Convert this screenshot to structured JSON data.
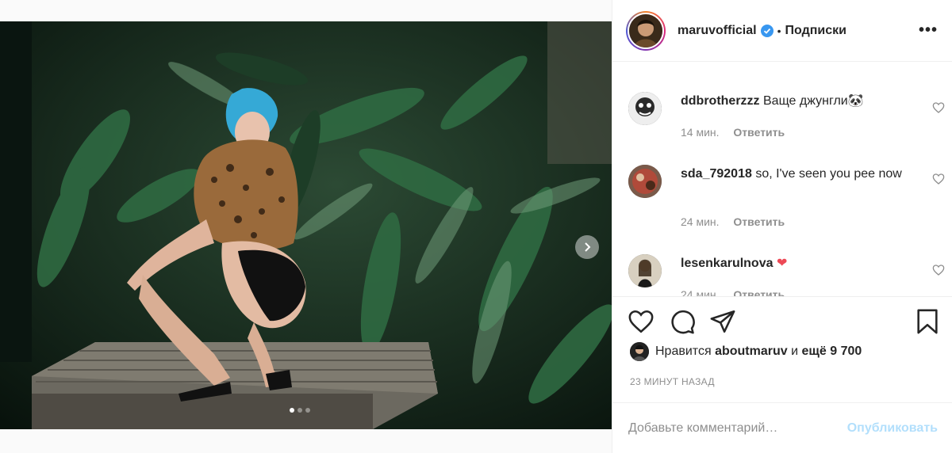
{
  "post": {
    "author": "maruvofficial",
    "separator": "•",
    "follow_label": "Подписки",
    "more_label": "•••",
    "slide_count": 3,
    "active_slide": 1
  },
  "comments": [
    {
      "username": "ddbrotherzzz",
      "text": "Ваще джунгли🐼",
      "time": "14 мин.",
      "reply": "Ответить"
    },
    {
      "username": "sda_792018",
      "text": "so, I've seen you pee now",
      "time": "24 мин.",
      "reply": "Ответить"
    },
    {
      "username": "lesenkarulnova",
      "text": "❤",
      "time": "24 мин.",
      "reply": "Ответить"
    }
  ],
  "likes": {
    "prefix": "Нравится",
    "user": "aboutmaruv",
    "joiner": "и",
    "others": "ещё 9 700"
  },
  "timestamp": "23 МИНУТ НАЗАД",
  "add_comment": {
    "placeholder": "Добавьте комментарий…",
    "publish_label": "Опубликовать"
  },
  "colors": {
    "verified": "#3897f0",
    "publish_disabled": "#b2dffc",
    "heart": "#ed4956"
  }
}
